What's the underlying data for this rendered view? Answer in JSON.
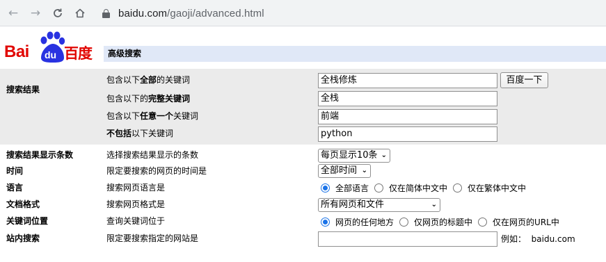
{
  "browser": {
    "url_host": "baidu.com",
    "url_path": "/gaoji/advanced.html"
  },
  "logo": {
    "latin": "Bai",
    "paw_text": "du",
    "chinese": "百度"
  },
  "page_title": "高级搜索",
  "search_results": {
    "category": "搜索结果",
    "all_words": {
      "prefix": "包含以下",
      "bold": "全部",
      "suffix": "的关键词",
      "value": "全栈修炼"
    },
    "exact_phrase": {
      "prefix": "包含以下的",
      "bold": "完整关键词",
      "value": "全栈"
    },
    "any_word": {
      "prefix": "包含以下",
      "bold": "任意一个",
      "suffix": "关键词",
      "value": "前端"
    },
    "exclude": {
      "bold": "不包括",
      "suffix": "以下关键词",
      "value": "python"
    },
    "submit_label": "百度一下"
  },
  "rows": {
    "count": {
      "category": "搜索结果显示条数",
      "desc": "选择搜索结果显示的条数",
      "selected": "每页显示10条"
    },
    "time": {
      "category": "时间",
      "desc": "限定要搜索的网页的时间是",
      "selected": "全部时间"
    },
    "language": {
      "category": "语言",
      "desc": "搜索网页语言是",
      "options": [
        "全部语言",
        "仅在简体中文中",
        "仅在繁体中文中"
      ],
      "selected_index": 0
    },
    "format": {
      "category": "文档格式",
      "desc": "搜索网页格式是",
      "selected": "所有网页和文件"
    },
    "position": {
      "category": "关键词位置",
      "desc": "查询关键词位于",
      "options": [
        "网页的任何地方",
        "仅网页的标题中",
        "仅在网页的URL中"
      ],
      "selected_index": 0
    },
    "site": {
      "category": "站内搜索",
      "desc": "限定要搜索指定的网站是",
      "value": "",
      "example_label": "例如：",
      "example_value": "baidu.com"
    }
  },
  "colors": {
    "brand_red": "#e10602",
    "brand_blue": "#2932e1",
    "title_bar_bg": "#e0e8f7",
    "grey_block": "#ebebeb",
    "radio_accent": "#1a73e8"
  }
}
